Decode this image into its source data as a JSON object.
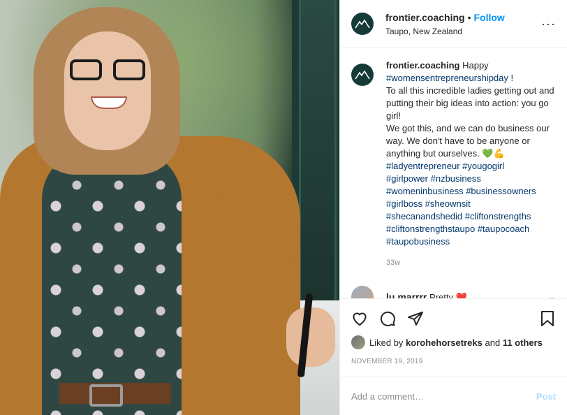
{
  "header": {
    "username": "frontier.coaching",
    "separator": "•",
    "follow_label": "Follow",
    "location": "Taupo, New Zealand",
    "more_label": "···"
  },
  "caption": {
    "username": "frontier.coaching",
    "text_1": "Happy",
    "tag_1": "#womensentrepreneurshipday",
    "text_2": "!",
    "line_1": "To all this incredible ladies getting out and putting their big ideas into action: you go girl!",
    "line_2": "We got this, and we can do business our way. We don't have to be anyone or anything but ourselves.",
    "emojis": "💚💪",
    "hashtags": [
      "#ladyentrepreneur",
      "#yougogirl",
      "#girlpower",
      "#nzbusiness",
      "#womeninbusiness",
      "#businessowners",
      "#girlboss",
      "#sheownsit",
      "#shecanandshedid",
      "#cliftonstrengths",
      "#cliftonstrengthstaupo",
      "#taupocoach",
      "#taupobusiness"
    ],
    "time": "33w"
  },
  "reply": {
    "username": "lu.marrrr",
    "text": "Pretty",
    "emoji": "❤️"
  },
  "likes": {
    "prefix": "Liked by",
    "user": "korohehorsetreks",
    "and": "and",
    "others": "11 others"
  },
  "date": "NOVEMBER 19, 2019",
  "comment_box": {
    "placeholder": "Add a comment…",
    "post_label": "Post"
  },
  "colors": {
    "accent": "#0095f6",
    "hashtag": "#00376b",
    "avatar_bg": "#163a37"
  }
}
